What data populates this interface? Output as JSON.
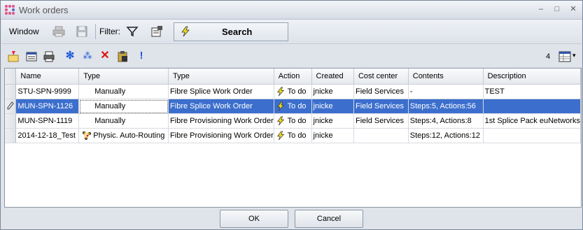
{
  "window": {
    "title": "Work orders",
    "minimize_glyph": "–",
    "maximize_glyph": "□",
    "close_glyph": "✕",
    "dropdown_glyph": "▾"
  },
  "toolbar": {
    "window_label": "Window",
    "filter_label": "Filter:",
    "search_label": "Search"
  },
  "toolbar2": {
    "count": "4"
  },
  "grid": {
    "columns": [
      "Name",
      "Type",
      "Type",
      "Action",
      "Created",
      "Cost center",
      "Contents",
      "Description"
    ],
    "rows": [
      {
        "name": "STU-SPN-9999",
        "type1": "Manually",
        "type2": "Fibre Splice Work Order",
        "action": "To do",
        "created": "jnicke",
        "cost_center": "Field Services",
        "contents": "-",
        "description": "TEST"
      },
      {
        "name": "MUN-SPN-1126",
        "type1": "Manually",
        "type2": "Fibre Splice Work Order",
        "action": "To do",
        "created": "jnicke",
        "cost_center": "Field Services",
        "contents": "Steps:5, Actions:56",
        "description": ""
      },
      {
        "name": "MUN-SPN-1119",
        "type1": "Manually",
        "type2": "Fibre Provisioning Work Order",
        "action": "To do",
        "created": "jnicke",
        "cost_center": "Field Services",
        "contents": "Steps:4, Actions:8",
        "description": "1st Splice Pack euNetworks"
      },
      {
        "name": "2014-12-18_Test",
        "type1": "Physic. Auto-Routing",
        "type2": "Fibre Provisioning Work Order",
        "action": "To do",
        "created": "jnicke",
        "cost_center": "",
        "contents": "Steps:12, Actions:12",
        "description": ""
      }
    ]
  },
  "buttons": {
    "ok": "OK",
    "cancel": "Cancel"
  },
  "colors": {
    "selection": "#3c6fcd",
    "action_bolt": "#f5e020"
  }
}
